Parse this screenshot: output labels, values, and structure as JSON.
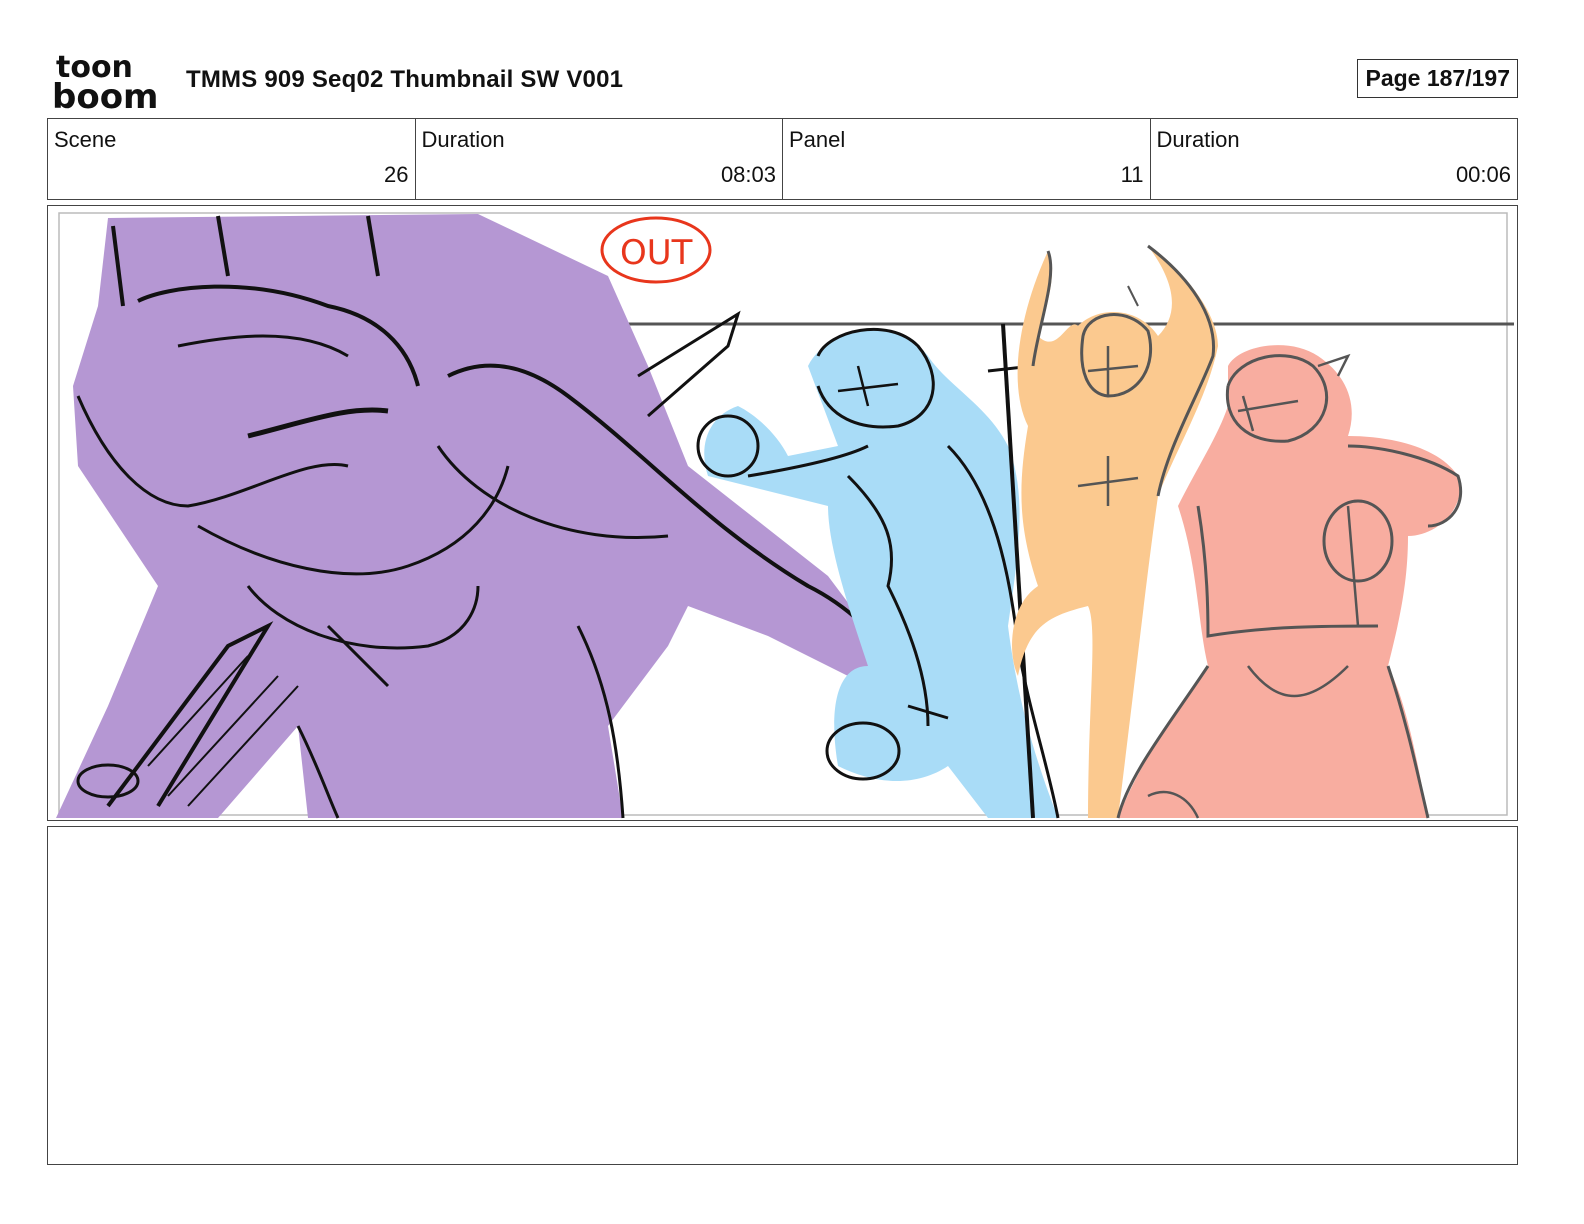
{
  "header": {
    "logo_top": "toon",
    "logo_bottom": "boom",
    "title": "TMMS 909 Seq02 Thumbnail SW V001",
    "page": "Page 187/197"
  },
  "info": {
    "scene_label": "Scene",
    "scene_value": "26",
    "scene_duration_label": "Duration",
    "scene_duration_value": "08:03",
    "panel_label": "Panel",
    "panel_value": "11",
    "panel_duration_label": "Duration",
    "panel_duration_value": "00:06"
  },
  "panel_image": {
    "annotation": "OUT",
    "colors": {
      "purple": "#b597d3",
      "blue": "#a9dcf7",
      "orange": "#fbc98f",
      "red": "#f8ada0",
      "annotation": "#e8361c"
    }
  },
  "notes": {
    "text": ""
  }
}
